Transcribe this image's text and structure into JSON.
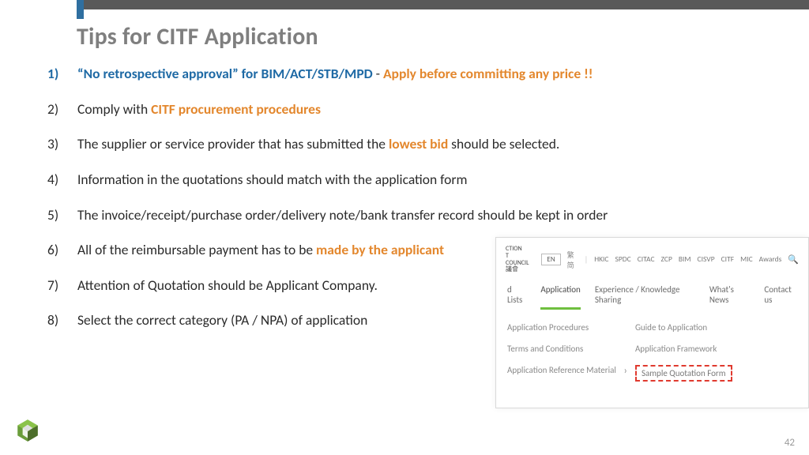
{
  "title": "Tips for CITF Application",
  "tips": {
    "i1_blue": "“No retrospective approval” for BIM/ACT/STB/MPD",
    "i1_dash": " - ",
    "i1_orange": "Apply before committing any price !!",
    "i2_a": "Comply with ",
    "i2_orange": "CITF procurement procedures",
    "i3_a": "The supplier or service provider that has submitted the ",
    "i3_orange": "lowest bid",
    "i3_b": " should be selected.",
    "i4": "Information in the quotations should match with the application form",
    "i5": "The invoice/receipt/purchase order/delivery note/bank transfer record should be kept in order",
    "i6_a": "All of the reimbursable payment has to be ",
    "i6_orange": "made by the applicant",
    "i7": "Attention of Quotation should be Applicant Company.",
    "i8": "Select the correct category (PA / NPA) of application"
  },
  "web": {
    "logo_line1": "CTION",
    "logo_line2": "T COUNCIL",
    "logo_line3": "議會",
    "lang_en": "EN",
    "lang_rest": "繁 简",
    "brands": [
      "HKIC",
      "SPDC",
      "CITAC",
      "ZCP",
      "BIM",
      "CISVP",
      "CITF",
      "MIC",
      "Awards"
    ],
    "nav": {
      "lists": "d Lists",
      "application": "Application",
      "eks": "Experience / Knowledge Sharing",
      "news": "What's News",
      "contact": "Contact us"
    },
    "sub_left": {
      "procedures": "Application Procedures",
      "terms": "Terms and Conditions",
      "refmat": "Application Reference Material"
    },
    "sub_right": {
      "guide": "Guide to Application",
      "framework": "Application Framework",
      "sample": "Sample Quotation Form"
    }
  },
  "page_number": "42"
}
